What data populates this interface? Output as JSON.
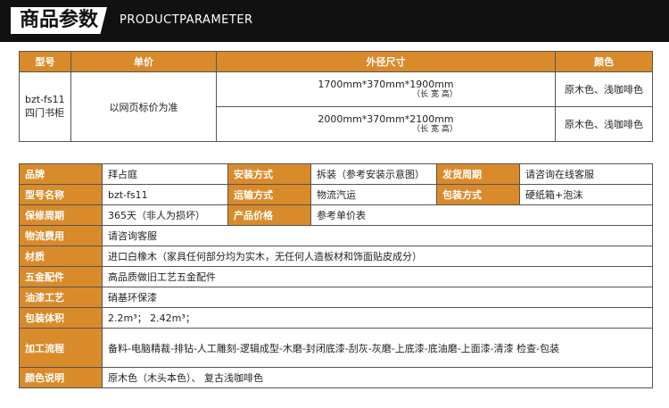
{
  "banner": {
    "title": "商品参数",
    "subtitle": "PRODUCTPARAMETER"
  },
  "table1": {
    "headers": [
      "型号",
      "单价",
      "外径尺寸",
      "颜色"
    ],
    "model": "bzt-fs11 四门书柜",
    "price": "以网页标价为准",
    "rows": [
      {
        "size": "1700mm*370mm*1900mm",
        "note": "（长 宽 高）",
        "color": "原木色、浅咖啡色"
      },
      {
        "size": "2000mm*370mm*2100mm",
        "note": "（长 宽 高）",
        "color": "原木色、浅咖啡色"
      }
    ]
  },
  "table2": {
    "brand_label": "品牌",
    "brand_value": "拜占庭",
    "install_label": "安装方式",
    "install_value": "拆装（参考安装示意图）",
    "ship_label": "发货周期",
    "ship_value": "请咨询在线客服",
    "model_label": "型号名称",
    "model_value": "bzt-fs11",
    "transport_label": "运输方式",
    "transport_value": "物流汽运",
    "pack_label": "包装方式",
    "pack_value": "硬纸箱+泡沫",
    "warranty_label": "保修周期",
    "warranty_value": "365天（非人为损坏）",
    "price_label": "产品价格",
    "price_value": "参考单价表",
    "logistics_label": "物流费用",
    "logistics_value": "请咨询客服",
    "material_label": "材质",
    "material_value": "进口白橡木（家具任何部分均为实木，无任何人造板材和饰面贴皮成分）",
    "hardware_label": "五金配件",
    "hardware_value": "高品质做旧工艺五金配件",
    "paint_label": "油漆工艺",
    "paint_value": "硝基环保漆",
    "volume_label": "包装体积",
    "volume_value": "2.2m³；  2.42m³；",
    "process_label": "加工流程",
    "process_value": "备料-电脑精裁-排钻-人工雕刻-逻辑成型-木磨-封闭底漆-刮灰-灰磨-上底漆-底油磨-上面漆-清漆 检查-包装",
    "color_label": "颜色说明",
    "color_value": "原木色（木头本色）、 复古浅咖啡色"
  }
}
